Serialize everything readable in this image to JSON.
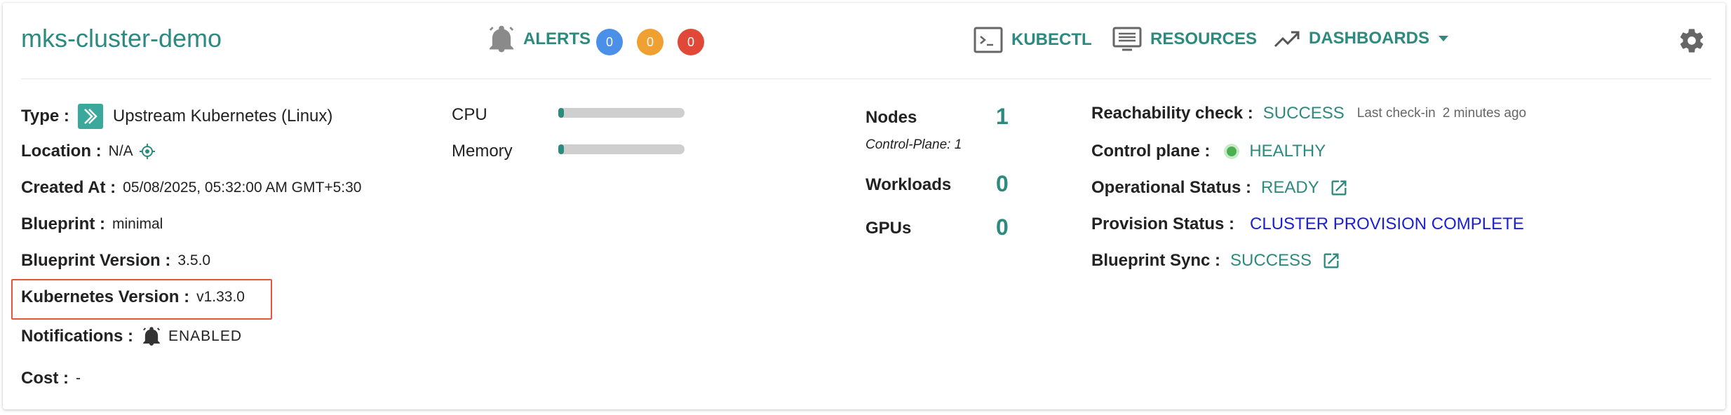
{
  "header": {
    "cluster_name": "mks-cluster-demo",
    "alerts_label": "ALERTS",
    "alert_counts": [
      {
        "value": "0",
        "color": "#4a8fe8"
      },
      {
        "value": "0",
        "color": "#f0a030"
      },
      {
        "value": "0",
        "color": "#e04838"
      }
    ],
    "kubectl_label": "KUBECTL",
    "resources_label": "RESOURCES",
    "dashboards_label": "DASHBOARDS"
  },
  "details": {
    "type_label": "Type :",
    "type_value": "Upstream Kubernetes (Linux)",
    "location_label": "Location :",
    "location_value": "N/A",
    "created_label": "Created At :",
    "created_value": "05/08/2025, 05:32:00 AM GMT+5:30",
    "blueprint_label": "Blueprint :",
    "blueprint_value": "minimal",
    "blueprint_version_label": "Blueprint Version :",
    "blueprint_version_value": "3.5.0",
    "k8s_version_label": "Kubernetes Version :",
    "k8s_version_value": "v1.33.0",
    "notifications_label": "Notifications :",
    "notifications_value": "ENABLED",
    "cost_label": "Cost :",
    "cost_value": "-"
  },
  "usage": {
    "cpu_label": "CPU",
    "cpu_fraction": 0.03,
    "memory_label": "Memory",
    "memory_fraction": 0.03
  },
  "counts": {
    "nodes_label": "Nodes",
    "nodes_value": "1",
    "control_plane_note": "Control-Plane: 1",
    "workloads_label": "Workloads",
    "workloads_value": "0",
    "gpus_label": "GPUs",
    "gpus_value": "0"
  },
  "status": {
    "reachability_label": "Reachability check :",
    "reachability_value": "SUCCESS",
    "last_checkin_label": "Last check-in",
    "last_checkin_value": "2 minutes ago",
    "control_plane_label": "Control plane :",
    "control_plane_value": "HEALTHY",
    "operational_label": "Operational Status :",
    "operational_value": "READY",
    "provision_label": "Provision Status :",
    "provision_value": "CLUSTER PROVISION COMPLETE",
    "blueprint_sync_label": "Blueprint Sync :",
    "blueprint_sync_value": "SUCCESS"
  },
  "colors": {
    "accent": "#2d8a7e",
    "healthy_dot": "#4caf50",
    "provision_blue": "#1a20d6",
    "highlight_border": "#e4553a"
  },
  "icons": {
    "alerts": "bell-icon",
    "kubectl": "terminal-icon",
    "resources": "list-icon",
    "dashboards": "trending-up-icon",
    "settings": "gear-icon",
    "type": "kubernetes-icon",
    "location": "location-target-icon",
    "notifications": "bell-icon",
    "external": "external-link-icon"
  }
}
